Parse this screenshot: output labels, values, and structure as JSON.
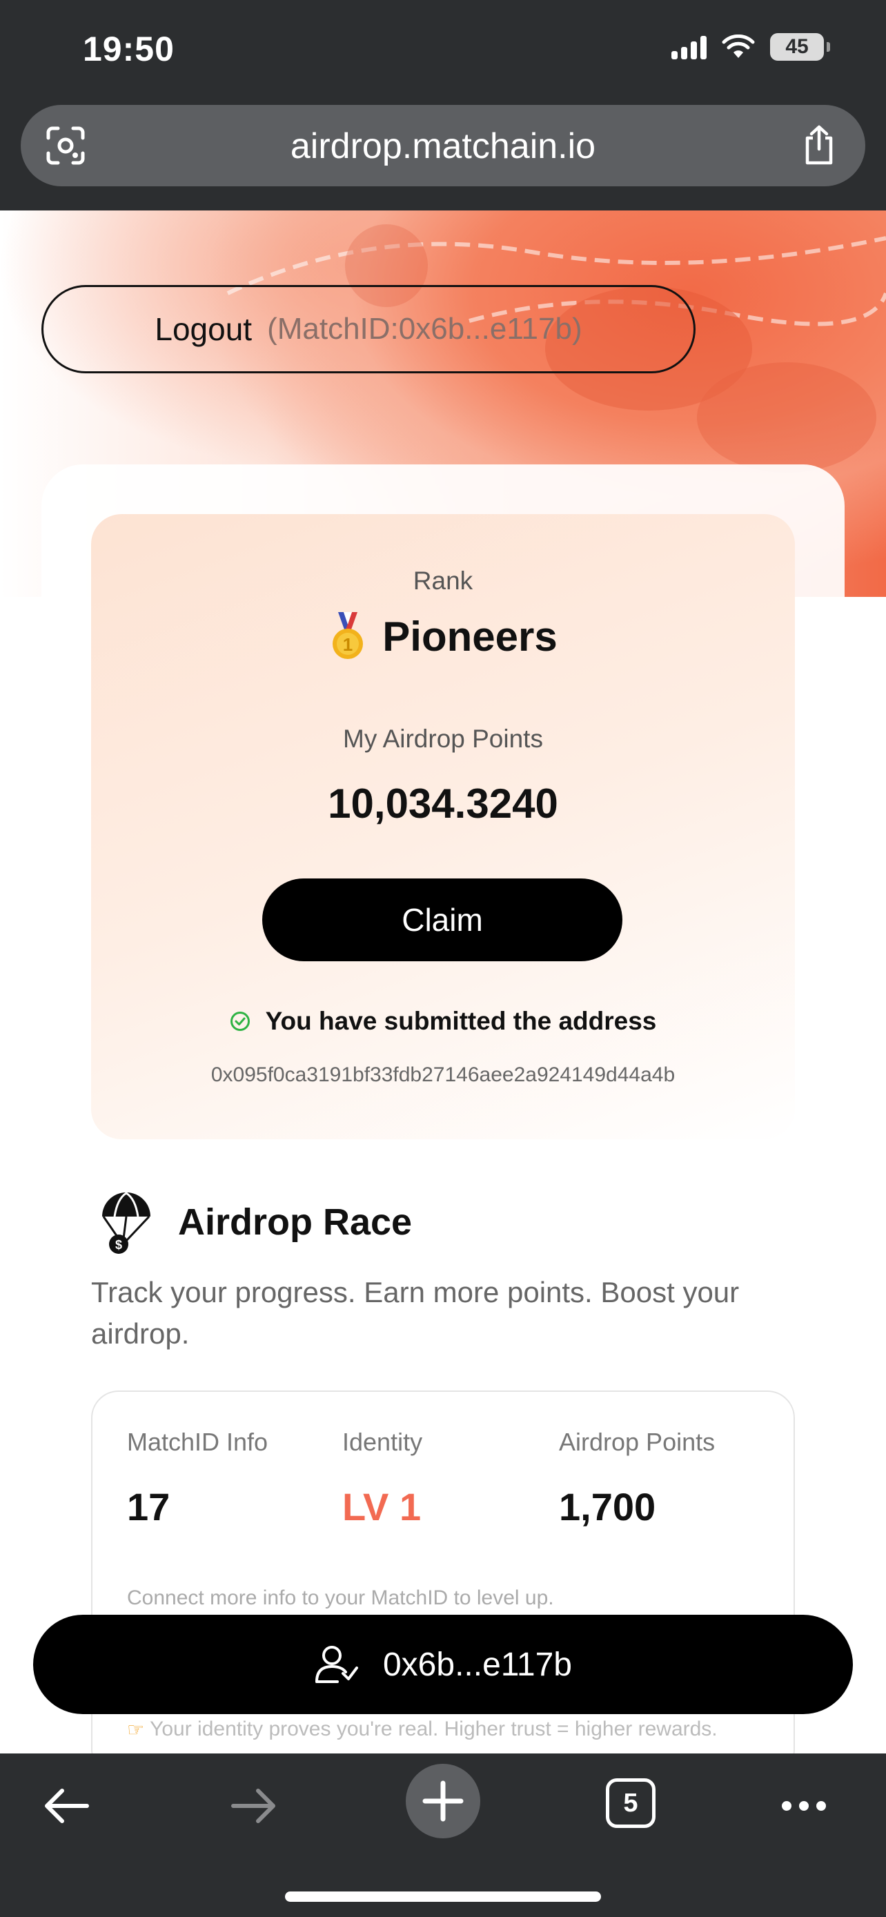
{
  "status_bar": {
    "time": "19:50",
    "battery": "45"
  },
  "browser": {
    "url": "airdrop.matchain.io",
    "tab_count": "5"
  },
  "header": {
    "logout_label": "Logout",
    "matchid": "(MatchID:0x6b...e117b)"
  },
  "rank_card": {
    "rank_label": "Rank",
    "rank_name": "Pioneers",
    "points_label": "My Airdrop Points",
    "points_value": "10,034.3240",
    "claim_label": "Claim",
    "submitted_text": "You have submitted the address",
    "address": "0x095f0ca3191bf33fdb27146aee2a924149d44a4b"
  },
  "airdrop_race": {
    "title": "Airdrop Race",
    "description": "Track your progress. Earn more points. Boost your airdrop.",
    "columns": [
      {
        "label": "MatchID Info",
        "value": "17"
      },
      {
        "label": "Identity",
        "value": "LV 1"
      },
      {
        "label": "Airdrop Points",
        "value": "1,700"
      }
    ],
    "note": "Connect more info to your MatchID to level up.",
    "tip": "Your identity proves you're real. Higher trust = higher rewards."
  },
  "wallet": {
    "address": "0x6b...e117b"
  },
  "colors": {
    "accent": "#f26a52",
    "check": "#2fb344"
  }
}
